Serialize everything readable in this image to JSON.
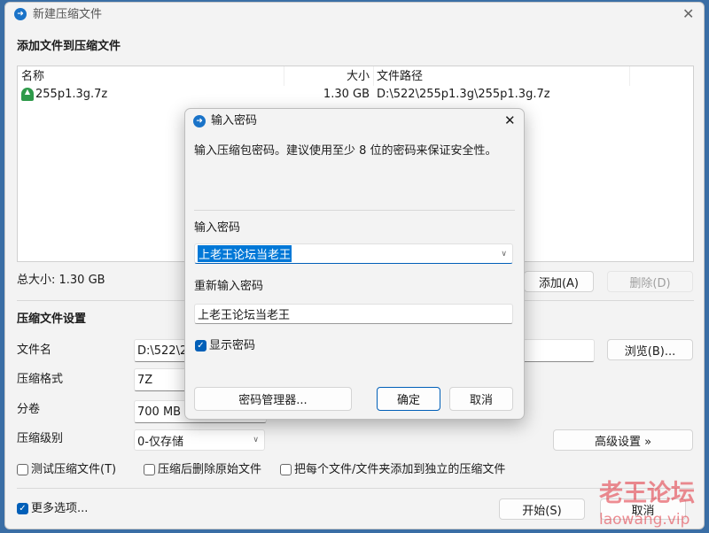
{
  "main": {
    "title": "新建压缩文件",
    "section_add": "添加文件到压缩文件",
    "columns": [
      "名称",
      "大小",
      "文件路径"
    ],
    "files": [
      {
        "name": "255p1.3g.7z",
        "size": "1.30 GB",
        "path": "D:\\522\\255p1.3g\\255p1.3g.7z"
      }
    ],
    "total_size": "总大小: 1.30 GB",
    "add_button": "添加(A)",
    "delete_button": "删除(D)",
    "section_settings": "压缩文件设置",
    "filename_label": "文件名",
    "filename_value": "D:\\522\\255",
    "browse_button": "浏览(B)...",
    "format_label": "压缩格式",
    "format_value": "7Z",
    "volume_label": "分卷",
    "volume_value": "700 MB (",
    "level_label": "压缩级别",
    "level_value": "0-仅存储",
    "advanced_button": "高级设置 »",
    "options": [
      {
        "label": "测试压缩文件(T)",
        "checked": false
      },
      {
        "label": "压缩后删除原始文件",
        "checked": false
      },
      {
        "label": "把每个文件/文件夹添加到独立的压缩文件",
        "checked": false
      }
    ],
    "more_options": {
      "label": "更多选项...",
      "checked": true
    },
    "start_button": "开始(S)",
    "cancel_button": "取消"
  },
  "dialog": {
    "title": "输入密码",
    "message": "输入压缩包密码。建议使用至少 8 位的密码来保证安全性。",
    "password_label": "输入密码",
    "password_value": "上老王论坛当老王",
    "confirm_label": "重新输入密码",
    "confirm_value": "上老王论坛当老王",
    "show_password": {
      "label": "显示密码",
      "checked": true
    },
    "manager_button": "密码管理器...",
    "ok_button": "确定",
    "cancel_button": "取消"
  },
  "watermark": {
    "line1": "老王论坛",
    "line2": "laowang.vip"
  },
  "colors": {
    "accent": "#005fb8",
    "watermark": "#e0303a"
  }
}
